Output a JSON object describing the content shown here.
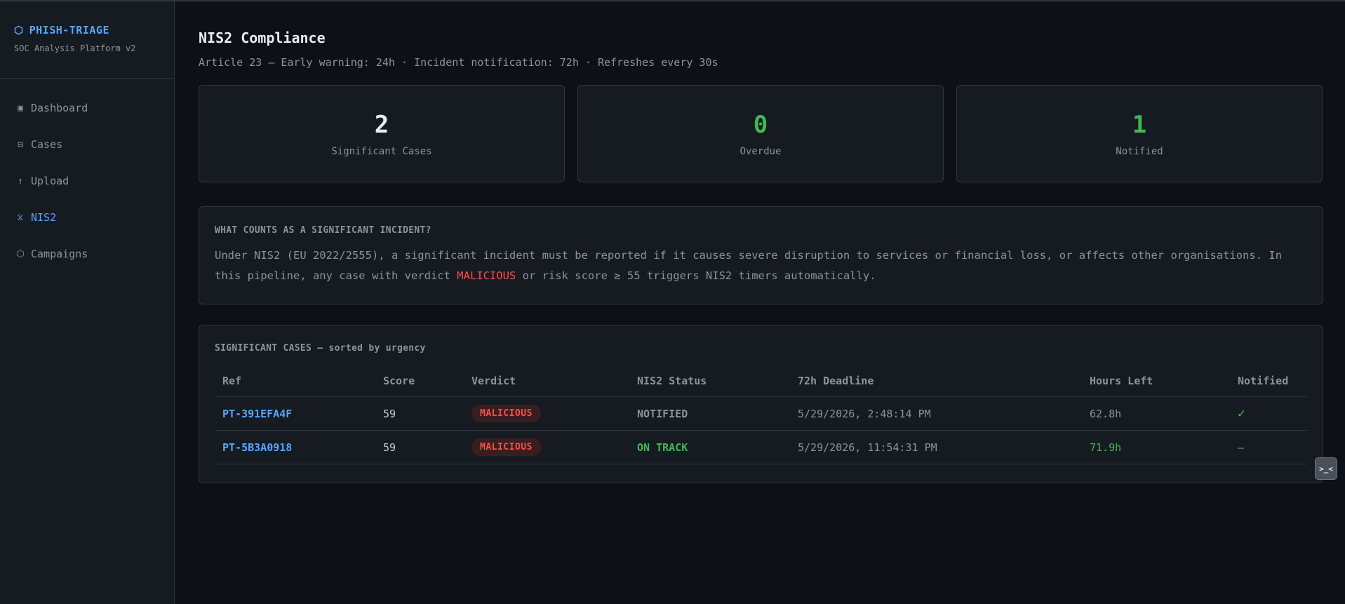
{
  "app": {
    "brand": "PHISH-TRIAGE",
    "brand_icon": "hexagon-icon",
    "subtitle": "SOC Analysis Platform v2"
  },
  "sidebar": {
    "items": [
      {
        "label": "Dashboard",
        "icon": "square-icon",
        "glyph": "▣",
        "active": false
      },
      {
        "label": "Cases",
        "icon": "cases-icon",
        "glyph": "⊟",
        "active": false
      },
      {
        "label": "Upload",
        "icon": "upload-arrow-icon",
        "glyph": "↑",
        "active": false
      },
      {
        "label": "NIS2",
        "icon": "hourglass-icon",
        "glyph": "⧖",
        "active": true
      },
      {
        "label": "Campaigns",
        "icon": "hexagon-outline-icon",
        "glyph": "⬡",
        "active": false
      }
    ]
  },
  "page": {
    "title": "NIS2 Compliance",
    "subtitle": "Article 23 — Early warning: 24h · Incident notification: 72h · Refreshes every 30s"
  },
  "stats": [
    {
      "value": "2",
      "label": "Significant Cases",
      "color": "#e6edf3"
    },
    {
      "value": "0",
      "label": "Overdue",
      "color": "#3fb950"
    },
    {
      "value": "1",
      "label": "Notified",
      "color": "#3fb950"
    }
  ],
  "info": {
    "heading": "WHAT COUNTS AS A SIGNIFICANT INCIDENT?",
    "text_before": "Under NIS2 (EU 2022/2555), a significant incident must be reported if it causes severe disruption to services or financial loss, or affects other organisations. In this pipeline, any case with verdict ",
    "highlight": "MALICIOUS",
    "text_after": " or risk score ≥ 55 triggers NIS2 timers automatically."
  },
  "cases": {
    "heading": "SIGNIFICANT CASES — sorted by urgency",
    "columns": [
      "Ref",
      "Score",
      "Verdict",
      "NIS2 Status",
      "72h Deadline",
      "Hours Left",
      "Notified"
    ],
    "rows": [
      {
        "ref": "PT-391EFA4F",
        "score": "59",
        "verdict": "MALICIOUS",
        "status": "NOTIFIED",
        "deadline": "5/29/2026, 2:48:14 PM",
        "hours_left": "62.8h",
        "notified": "✓"
      },
      {
        "ref": "PT-5B3A0918",
        "score": "59",
        "verdict": "MALICIOUS",
        "status": "ON TRACK",
        "deadline": "5/29/2026, 11:54:31 PM",
        "hours_left": "71.9h",
        "notified": "—"
      }
    ]
  },
  "terminal_button": {
    "glyph": ">_<",
    "icon": "terminal-icon"
  },
  "colors": {
    "accent": "#58a6ff",
    "danger": "#f85149",
    "success": "#3fb950",
    "background": "#0d1117",
    "panel": "#161b22"
  }
}
